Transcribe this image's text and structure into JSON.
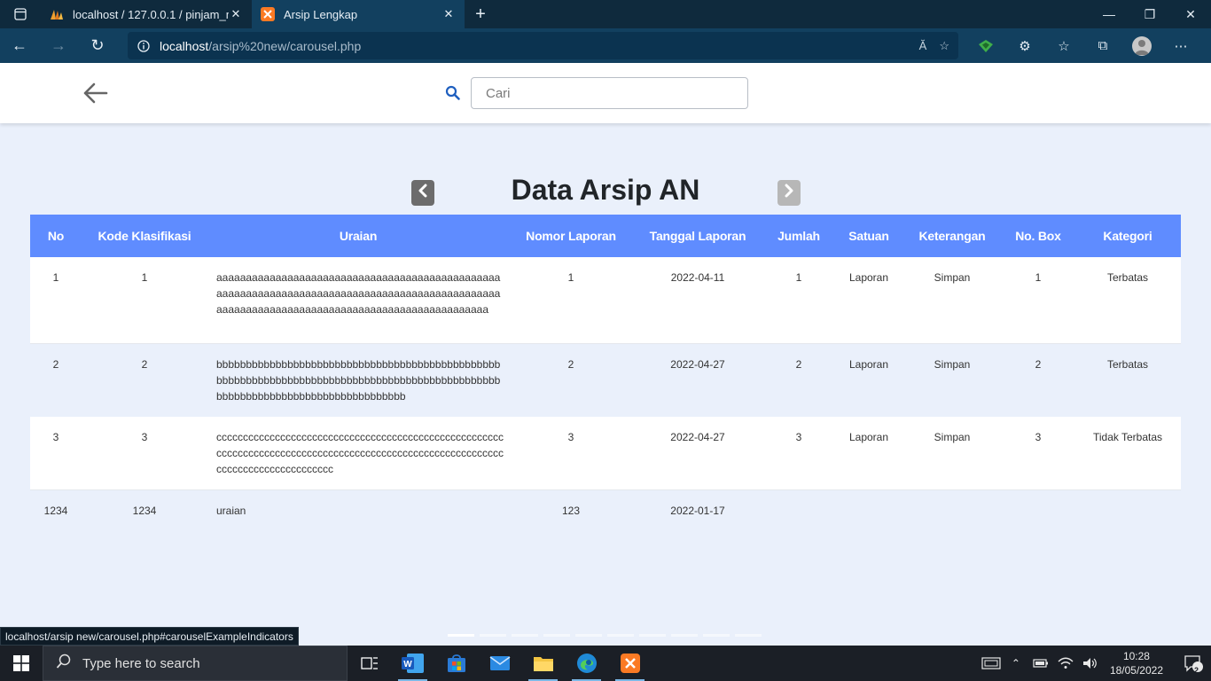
{
  "browser": {
    "tabs": [
      {
        "title": "localhost / 127.0.0.1 / pinjam_mo",
        "active": false,
        "favicon": "phpmyadmin-icon"
      },
      {
        "title": "Arsip Lengkap",
        "active": true,
        "favicon": "xampp-icon"
      }
    ],
    "url_host": "localhost",
    "url_path": "/arsip%20new/carousel.php",
    "status_url": "localhost/arsip new/carousel.php#carouselExampleIndicators",
    "aria_read_label": "Ă"
  },
  "header": {
    "search_placeholder": "Cari"
  },
  "carousel": {
    "title": "Data Arsip AN",
    "indicator_count": 10,
    "active_index": 0
  },
  "table": {
    "columns": [
      "No",
      "Kode Klasifikasi",
      "Uraian",
      "Nomor Laporan",
      "Tanggal Laporan",
      "Jumlah",
      "Satuan",
      "Keterangan",
      "No. Box",
      "Kategori"
    ],
    "rows": [
      {
        "no": "1",
        "kode": "1",
        "uraian": "aaaaaaaaaaaaaaaaaaaaaaaaaaaaaaaaaaaaaaaaaaaaaaaaaaaaaaaaaaaaaaaaaaaaaaaaaaaaaaaaaaaaaaaaaaaaaaaaaaaaaaaaaaaaaaaaaaaaaaaaaaaaaaaaaaaaaaaaaaaaaa",
        "nomor": "1",
        "tanggal": "2022-04-11",
        "jumlah": "1",
        "satuan": "Laporan",
        "keterangan": "Simpan",
        "box": "1",
        "kategori": "Terbatas"
      },
      {
        "no": "2",
        "kode": "2",
        "uraian": "bbbbbbbbbbbbbbbbbbbbbbbbbbbbbbbbbbbbbbbbbbbbbbbbbbbbbbbbbbbbbbbbbbbbbbbbbbbbbbbbbbbbbbbbbbbbbbbbbbbbbbbbbbbbbbbbbbbbbbbbbbbbbbbb",
        "nomor": "2",
        "tanggal": "2022-04-27",
        "jumlah": "2",
        "satuan": "Laporan",
        "keterangan": "Simpan",
        "box": "2",
        "kategori": "Terbatas"
      },
      {
        "no": "3",
        "kode": "3",
        "uraian": "cccccccccccccccccccccccccccccccccccccccccccccccccccccccccccccccccccccccccccccccccccccccccccccccccccccccccccccccccccccccccccccccccc",
        "nomor": "3",
        "tanggal": "2022-04-27",
        "jumlah": "3",
        "satuan": "Laporan",
        "keterangan": "Simpan",
        "box": "3",
        "kategori": "Tidak Terbatas"
      },
      {
        "no": "1234",
        "kode": "1234",
        "uraian": "uraian",
        "nomor": "123",
        "tanggal": "2022-01-17",
        "jumlah": "",
        "satuan": "",
        "keterangan": "",
        "box": "",
        "kategori": ""
      }
    ]
  },
  "taskbar": {
    "search_placeholder": "Type here to search",
    "time": "10:28",
    "date": "18/05/2022",
    "notification_count": "2"
  },
  "colors": {
    "header_blue": "#5f8cff",
    "page_bg": "#eaf0fb",
    "browser_dark": "#0f2a3d",
    "browser_bar": "#12405f"
  }
}
